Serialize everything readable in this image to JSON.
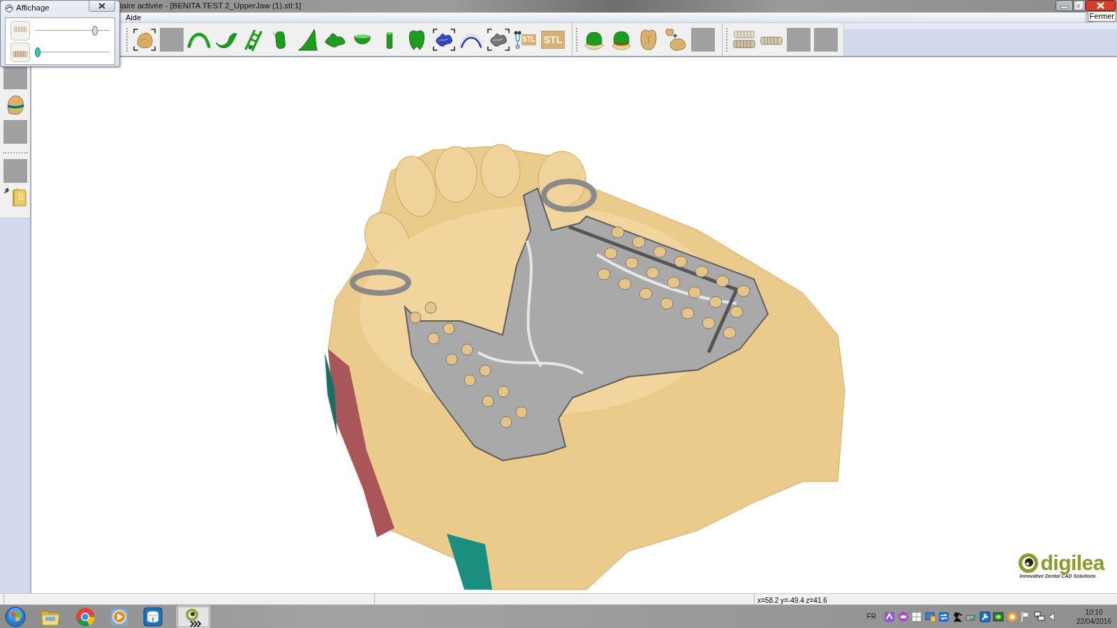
{
  "window": {
    "title": "iaire activée - [BENITA TEST 2_UpperJaw (1).stl:1]"
  },
  "menu": [
    {
      "label": "Aide"
    }
  ],
  "tooltip": {
    "text": "Fermer"
  },
  "panel": {
    "title": "Affichage",
    "layers": [
      {
        "kind": "upper",
        "level": 0.8,
        "active": false
      },
      {
        "kind": "lower",
        "level": 0.03,
        "active": true
      }
    ]
  },
  "toolbar": {
    "groups": [
      [
        {
          "kind": "jaw-frame"
        },
        {
          "kind": "empty"
        },
        {
          "kind": "arch"
        },
        {
          "kind": "hook"
        },
        {
          "kind": "ladder"
        },
        {
          "kind": "post"
        },
        {
          "kind": "fin"
        },
        {
          "kind": "blob"
        },
        {
          "kind": "cup"
        },
        {
          "kind": "pin"
        },
        {
          "kind": "tooth"
        },
        {
          "kind": "scan-frame"
        },
        {
          "kind": "band-arch"
        },
        {
          "kind": "scan-frame-gray"
        },
        {
          "kind": "stl-check",
          "label": "STL"
        },
        {
          "kind": "stl",
          "label": "STL"
        }
      ],
      [
        {
          "kind": "crown"
        },
        {
          "kind": "crown-red"
        },
        {
          "kind": "molar"
        },
        {
          "kind": "tooth-plus-jaw"
        },
        {
          "kind": "empty"
        }
      ],
      [
        {
          "kind": "teeth-rows"
        },
        {
          "kind": "teeth-row"
        },
        {
          "kind": "empty"
        },
        {
          "kind": "empty"
        }
      ]
    ]
  },
  "sidebar": {
    "groups": [
      [
        {
          "kind": "empty"
        },
        {
          "kind": "crown-band"
        },
        {
          "kind": "empty"
        }
      ],
      [
        {
          "kind": "empty"
        },
        {
          "kind": "folder"
        }
      ]
    ]
  },
  "viewport": {
    "logo": {
      "name": "digilea",
      "tagline": "Innovative Dental CAD Solutions"
    }
  },
  "status_bar": {
    "coordinates": "x=58.2 y=-49.4 z=41.6"
  },
  "taskbar": {
    "apps": [
      {
        "kind": "folder",
        "selected": false
      },
      {
        "kind": "browser",
        "selected": false
      },
      {
        "kind": "player",
        "selected": false
      },
      {
        "kind": "cylinder",
        "selected": false
      },
      {
        "kind": "logo-app",
        "selected": true
      }
    ],
    "language": "FR",
    "tray": [
      {
        "kind": "app"
      },
      {
        "kind": "disc"
      },
      {
        "kind": "window-grid"
      },
      {
        "kind": "monitor"
      },
      {
        "kind": "arrows"
      },
      {
        "kind": "figure"
      },
      {
        "kind": "drive"
      },
      {
        "kind": "wrench"
      },
      {
        "kind": "chip"
      },
      {
        "kind": "ring"
      },
      {
        "kind": "flag"
      },
      {
        "kind": "network"
      },
      {
        "kind": "speaker"
      }
    ],
    "time": "10:10",
    "date": "22/04/2016"
  }
}
